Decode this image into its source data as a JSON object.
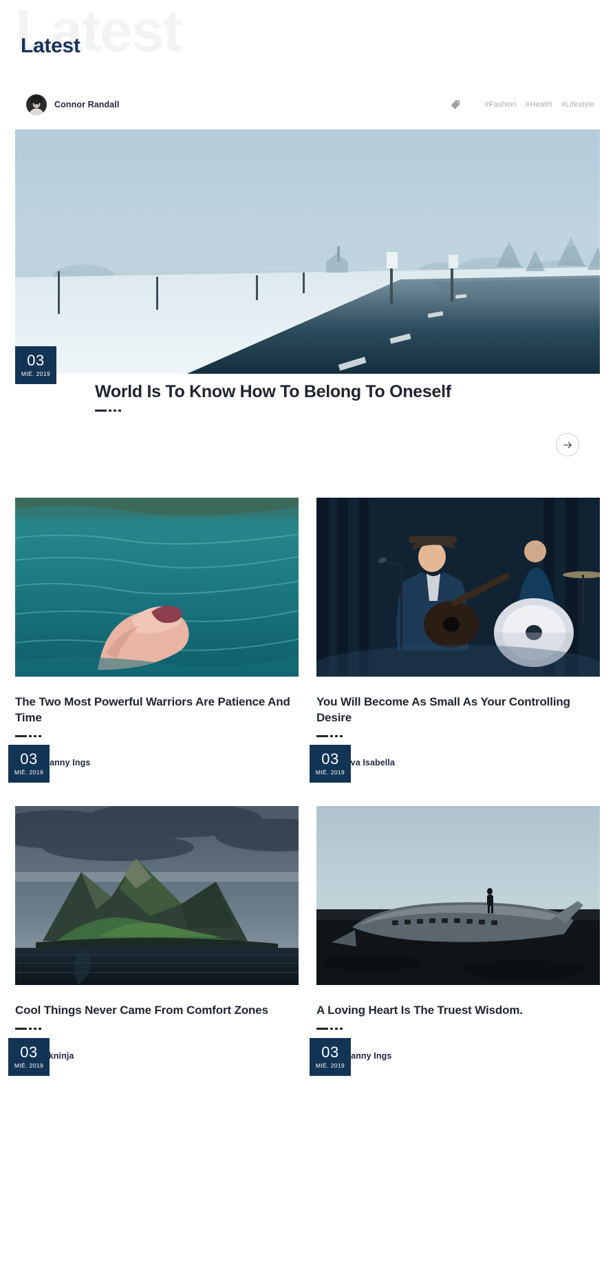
{
  "header": {
    "watermark": "Latest",
    "title": "Latest"
  },
  "meta_bar": {
    "author": {
      "name": "Connor Randall",
      "avatar": "avatar-connor-randall"
    },
    "tag_icon": "tag-icon",
    "tags": [
      "#Fashion",
      "#Health",
      "#Lifestyle"
    ]
  },
  "hero": {
    "image": "snowy-foggy-road-photo",
    "date": {
      "day": "03",
      "sub": "MIÉ. 2019"
    },
    "title": "World Is To Know How To Belong To Oneself",
    "next_button_icon": "arrow-right-icon"
  },
  "cards": [
    {
      "image": "hand-in-turquoise-ocean-photo",
      "date": {
        "day": "03",
        "sub": "MIÉ. 2019"
      },
      "title": "The Two Most Powerful Warriors Are Patience And Time",
      "author": {
        "name": "Danny Ings",
        "avatar": "avatar-danny-ings"
      }
    },
    {
      "image": "band-performing-on-stage-photo",
      "date": {
        "day": "03",
        "sub": "MIÉ. 2019"
      },
      "title": "You Will Become As Small As Your Controlling Desire",
      "author": {
        "name": "Ava Isabella",
        "avatar": "avatar-ava-isabella"
      }
    },
    {
      "image": "green-mountain-island-fjord-photo",
      "date": {
        "day": "03",
        "sub": "MIÉ. 2019"
      },
      "title": "Cool Things Never Came From Comfort Zones",
      "author": {
        "name": "bkninja",
        "avatar": "avatar-bkninja"
      }
    },
    {
      "image": "plane-wreck-iceland-photo",
      "date": {
        "day": "03",
        "sub": "MIÉ. 2019"
      },
      "title": "A Loving Heart Is The Truest Wisdom.",
      "author": {
        "name": "Danny Ings",
        "avatar": "avatar-danny-ings"
      }
    }
  ],
  "colors": {
    "accent_navy": "#123455",
    "title_dark": "#20262f",
    "watermark_gray": "#f2f3f4",
    "tag_gray": "#a7acb3"
  }
}
